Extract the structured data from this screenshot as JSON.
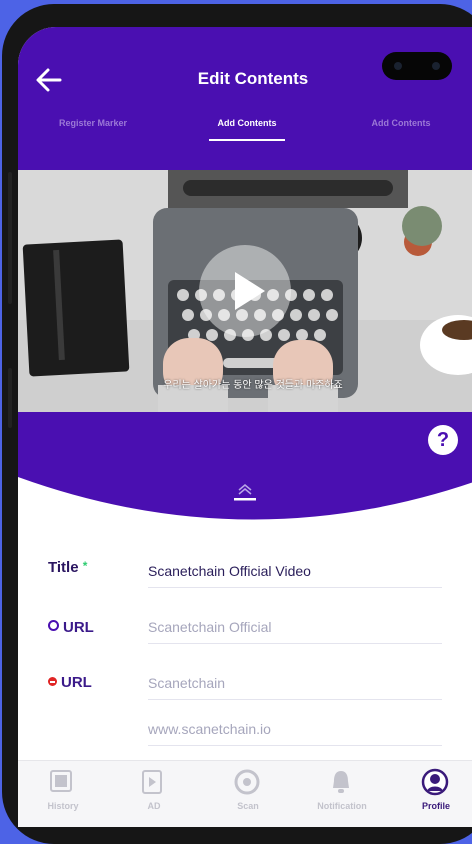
{
  "header": {
    "title": "Edit Contents"
  },
  "tabs": [
    {
      "label": "Register Marker",
      "active": false
    },
    {
      "label": "Add Contents",
      "active": true
    },
    {
      "label": "Add Contents",
      "active": false
    }
  ],
  "video": {
    "caption": "우리는 살아가는 동안 많은 것들과 마주하죠"
  },
  "help": {
    "label": "?"
  },
  "form": {
    "title": {
      "label": "Title",
      "required": "*",
      "value": "Scanetchain Official Video"
    },
    "url1": {
      "label": "URL",
      "value": "Scanetchain Official"
    },
    "url2": {
      "label": "URL",
      "value": "Scanetchain"
    },
    "url3": {
      "value": "www.scanetchain.io"
    }
  },
  "nav": [
    {
      "label": "History",
      "icon": "history-icon"
    },
    {
      "label": "AD",
      "icon": "ad-icon"
    },
    {
      "label": "Scan",
      "icon": "scan-icon"
    },
    {
      "label": "Notification",
      "icon": "bell-icon"
    },
    {
      "label": "Profile",
      "icon": "profile-icon",
      "active": true
    }
  ],
  "colors": {
    "primary": "#4a0fb1",
    "background": "#4d63e6",
    "required": "#2ecc71",
    "url1_marker": "#4a0fb1",
    "url2_marker": "#e02424"
  }
}
